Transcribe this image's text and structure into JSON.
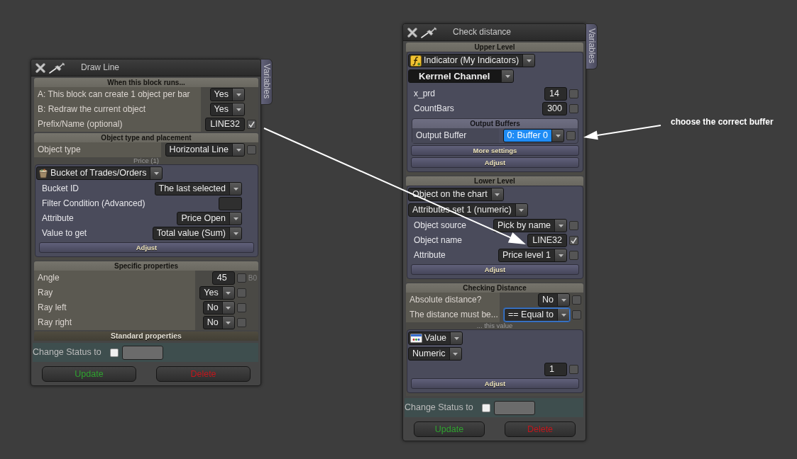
{
  "panels": [
    {
      "title": "Draw Line",
      "side_tab": "Variables",
      "sections": [
        {
          "header": "When this block runs...",
          "highlighted": false,
          "items": [
            {
              "kind": "row",
              "label": "A: This block can create 1 object per bar",
              "control": {
                "kind": "select",
                "value": "Yes",
                "highlighted": false,
                "focused": false
              }
            },
            {
              "kind": "row",
              "label": "B: Redraw the current object",
              "control": {
                "kind": "select",
                "value": "Yes",
                "highlighted": false,
                "focused": false
              }
            },
            {
              "kind": "row",
              "label": "Prefix/Name (optional)",
              "control": {
                "kind": "input",
                "value": "LINE32"
              },
              "checkbox": {
                "checked": true
              }
            }
          ]
        },
        {
          "header": "Object type and placement",
          "highlighted": false,
          "items": [
            {
              "kind": "row",
              "label": "Object type",
              "control": {
                "kind": "select",
                "value": "Horizontal Line",
                "highlighted": false,
                "focused": false
              },
              "checkbox": {
                "checked": false
              }
            },
            {
              "kind": "caption",
              "text": "Price (1)"
            },
            {
              "kind": "subpanel",
              "items": [
                {
                  "kind": "trades-source",
                  "value": "Bucket of Trades/Orders"
                },
                {
                  "kind": "row",
                  "label": "Bucket ID",
                  "control": {
                    "kind": "select",
                    "value": "The last selected",
                    "highlighted": false,
                    "focused": false
                  }
                },
                {
                  "kind": "row",
                  "label": "Filter Condition (Advanced)",
                  "control": {
                    "kind": "blank"
                  }
                },
                {
                  "kind": "row",
                  "label": "Attribute",
                  "control": {
                    "kind": "select",
                    "value": "Price Open",
                    "highlighted": false,
                    "focused": false
                  }
                },
                {
                  "kind": "row",
                  "label": "Value to get",
                  "control": {
                    "kind": "select",
                    "value": "Total value (Sum)",
                    "highlighted": false,
                    "focused": false
                  }
                },
                {
                  "kind": "button",
                  "label": "Adjust"
                }
              ]
            }
          ]
        },
        {
          "header": "Specific properties",
          "highlighted": false,
          "items": [
            {
              "kind": "row",
              "label": "Angle",
              "control": {
                "kind": "input",
                "value": "45"
              },
              "checkbox": {
                "checked": false
              },
              "note": "B0"
            },
            {
              "kind": "row",
              "label": "Ray",
              "control": {
                "kind": "select",
                "value": "Yes",
                "highlighted": false,
                "focused": false
              },
              "checkbox": {
                "checked": false
              }
            },
            {
              "kind": "row",
              "label": "Ray left",
              "control": {
                "kind": "select",
                "value": "No",
                "highlighted": false,
                "focused": false
              },
              "checkbox": {
                "checked": false
              }
            },
            {
              "kind": "row",
              "label": "Ray right",
              "control": {
                "kind": "select",
                "value": "No",
                "highlighted": false,
                "focused": false
              },
              "checkbox": {
                "checked": false
              }
            }
          ]
        },
        {
          "header": "Standard properties",
          "highlighted": true
        }
      ],
      "status_row": {
        "label": "Change Status to",
        "checked": false
      },
      "buttons": [
        {
          "label": "Update",
          "color": "#2fa32f"
        },
        {
          "label": "Delete",
          "color": "#c3161c"
        }
      ]
    },
    {
      "title": "Check distance",
      "side_tab": "Variables",
      "sections": [
        {
          "header": "Upper Level",
          "highlighted": false,
          "items": [
            {
              "kind": "subpanel",
              "items": [
                {
                  "kind": "indicator-source",
                  "value": "Indicator (My Indicators)"
                },
                {
                  "kind": "title-select",
                  "value": "Kerrnel Channel"
                },
                {
                  "kind": "row",
                  "label": "x_prd",
                  "control": {
                    "kind": "input",
                    "value": "14"
                  },
                  "checkbox": {
                    "checked": false
                  }
                },
                {
                  "kind": "row",
                  "label": "CountBars",
                  "control": {
                    "kind": "input",
                    "value": "300"
                  },
                  "checkbox": {
                    "checked": false
                  }
                },
                {
                  "kind": "group",
                  "header": "Output Buffers",
                  "items": [
                    {
                      "kind": "row",
                      "label": "Output Buffer",
                      "control": {
                        "kind": "select",
                        "value": "0: Buffer 0",
                        "highlighted": true,
                        "focused": false
                      },
                      "checkbox": {
                        "checked": false
                      }
                    }
                  ]
                },
                {
                  "kind": "button",
                  "label": "More settings"
                },
                {
                  "kind": "button",
                  "label": "Adjust"
                }
              ]
            }
          ]
        },
        {
          "header": "Lower Level",
          "highlighted": false,
          "items": [
            {
              "kind": "subpanel",
              "items": [
                {
                  "kind": "wide-select",
                  "value": "Object on the chart"
                },
                {
                  "kind": "wide-select",
                  "value": "Attributes set 1 (numeric)"
                },
                {
                  "kind": "row",
                  "label": "Object source",
                  "control": {
                    "kind": "select",
                    "value": "Pick by name",
                    "highlighted": false,
                    "focused": false
                  },
                  "checkbox": {
                    "checked": false
                  }
                },
                {
                  "kind": "row",
                  "label": "Object name",
                  "control": {
                    "kind": "input",
                    "value": "LINE32"
                  },
                  "checkbox": {
                    "checked": true
                  }
                },
                {
                  "kind": "row",
                  "label": "Attribute",
                  "control": {
                    "kind": "select",
                    "value": "Price level 1",
                    "highlighted": false,
                    "focused": false
                  },
                  "checkbox": {
                    "checked": false
                  }
                },
                {
                  "kind": "button",
                  "label": "Adjust"
                }
              ]
            }
          ]
        },
        {
          "header": "Checking Distance",
          "highlighted": false,
          "items": [
            {
              "kind": "row",
              "label": "Absolute distance?",
              "control": {
                "kind": "select",
                "value": "No",
                "highlighted": false,
                "focused": false
              },
              "checkbox": {
                "checked": false
              }
            },
            {
              "kind": "row",
              "label": "The distance must be...",
              "control": {
                "kind": "select",
                "value": "== Equal to",
                "highlighted": false,
                "focused": true
              },
              "checkbox": {
                "checked": false
              }
            },
            {
              "kind": "caption",
              "text": "... this value"
            },
            {
              "kind": "subpanel",
              "items": [
                {
                  "kind": "value-source",
                  "value": "Value"
                },
                {
                  "kind": "wide-select",
                  "value": "Numeric"
                },
                {
                  "kind": "row",
                  "control": {
                    "kind": "input",
                    "value": "1"
                  },
                  "checkbox": {
                    "checked": false
                  }
                },
                {
                  "kind": "button",
                  "label": "Adjust"
                }
              ]
            }
          ]
        }
      ],
      "status_row": {
        "label": "Change Status to",
        "checked": false
      },
      "buttons": [
        {
          "label": "Update",
          "color": "#2fa32f"
        },
        {
          "label": "Delete",
          "color": "#c3161c"
        }
      ]
    }
  ],
  "annotations": [
    {
      "kind": "arrow"
    },
    {
      "kind": "callout",
      "text": "choose the correct buffer"
    }
  ]
}
